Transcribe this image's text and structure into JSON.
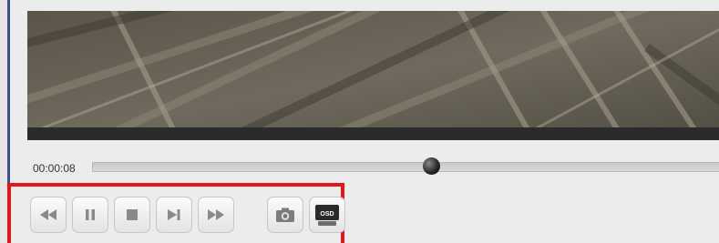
{
  "player": {
    "time": "00:00:08",
    "progress_fraction": 0.54
  },
  "controls": [
    {
      "name": "rewind-button",
      "icon": "rewind-icon"
    },
    {
      "name": "pause-button",
      "icon": "pause-icon"
    },
    {
      "name": "stop-button",
      "icon": "stop-icon"
    },
    {
      "name": "step-forward-button",
      "icon": "step-forward-icon"
    },
    {
      "name": "fast-forward-button",
      "icon": "fast-forward-icon"
    },
    {
      "name": "snapshot-button",
      "icon": "camera-icon"
    },
    {
      "name": "osd-button",
      "icon": "osd-icon",
      "label": "OSD"
    }
  ],
  "colors": {
    "highlight": "#e8141b",
    "icon_gray": "#8a8a8a"
  }
}
